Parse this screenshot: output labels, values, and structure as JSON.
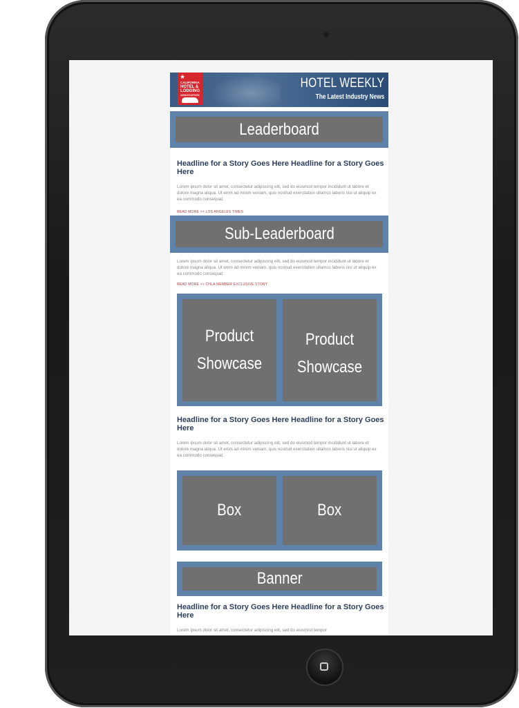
{
  "header": {
    "logo_lines": [
      "CALIFORNIA",
      "HOTEL &",
      "LODGING",
      "ASSOCIATION"
    ],
    "title": "HOTEL WEEKLY",
    "subtitle": "The Latest Industry News"
  },
  "ads": {
    "leaderboard": "Leaderboard",
    "sub_leaderboard": "Sub-Leaderboard",
    "product_showcase_1": "Product Showcase",
    "product_showcase_2": "Product Showcase",
    "box_1": "Box",
    "box_2": "Box",
    "banner": "Banner"
  },
  "stories": [
    {
      "headline": "Headline for a Story Goes Here Headline for a Story Goes Here",
      "body": "Lorem ipsum dolor sit amet, consectetur adipiscing elit, sed do eiusmod tempor incididunt ut labore et dolore magna aliqua. Ut enim ad minim veniam, quis nostrud exercitation ullamco laboris nisi ut aliquip ex ea commodo consequat.",
      "read_more": "READ MORE >> LOS ANGELES TIMES"
    },
    {
      "body": "Lorem ipsum dolor sit amet, consectetur adipiscing elit, sed do eiusmod tempor incididunt ut labore et dolore magna aliqua. Ut enim ad minim veniam, quis nostrud exercitation ullamco laboris nisi ut aliquip ex ea commodo consequat.",
      "read_more": "READ MORE >> CHLA MEMBER EXCLUSIVE STORY"
    },
    {
      "headline": "Headline for a Story Goes Here Headline for a Story Goes Here",
      "body": "Lorem ipsum dolor sit amet, consectetur adipiscing elit, sed do eiusmod tempor incididunt ut labore et dolore magna aliqua. Ut enim ad minim veniam, quis nostrud exercitation ullamco laboris nisi ut aliquip ex ea commodo consequat."
    },
    {
      "headline": "Headline for a Story Goes Here Headline for a Story Goes Here",
      "body": "Lorem ipsum dolor sit amet, consectetur adipiscing elit, sed do eiusmod tempor"
    }
  ],
  "colors": {
    "ad_frame": "#5f82aa",
    "ad_fill": "#707070",
    "logo_red": "#d6262b",
    "headline": "#2d3e5a",
    "read_more": "#b3383c"
  }
}
